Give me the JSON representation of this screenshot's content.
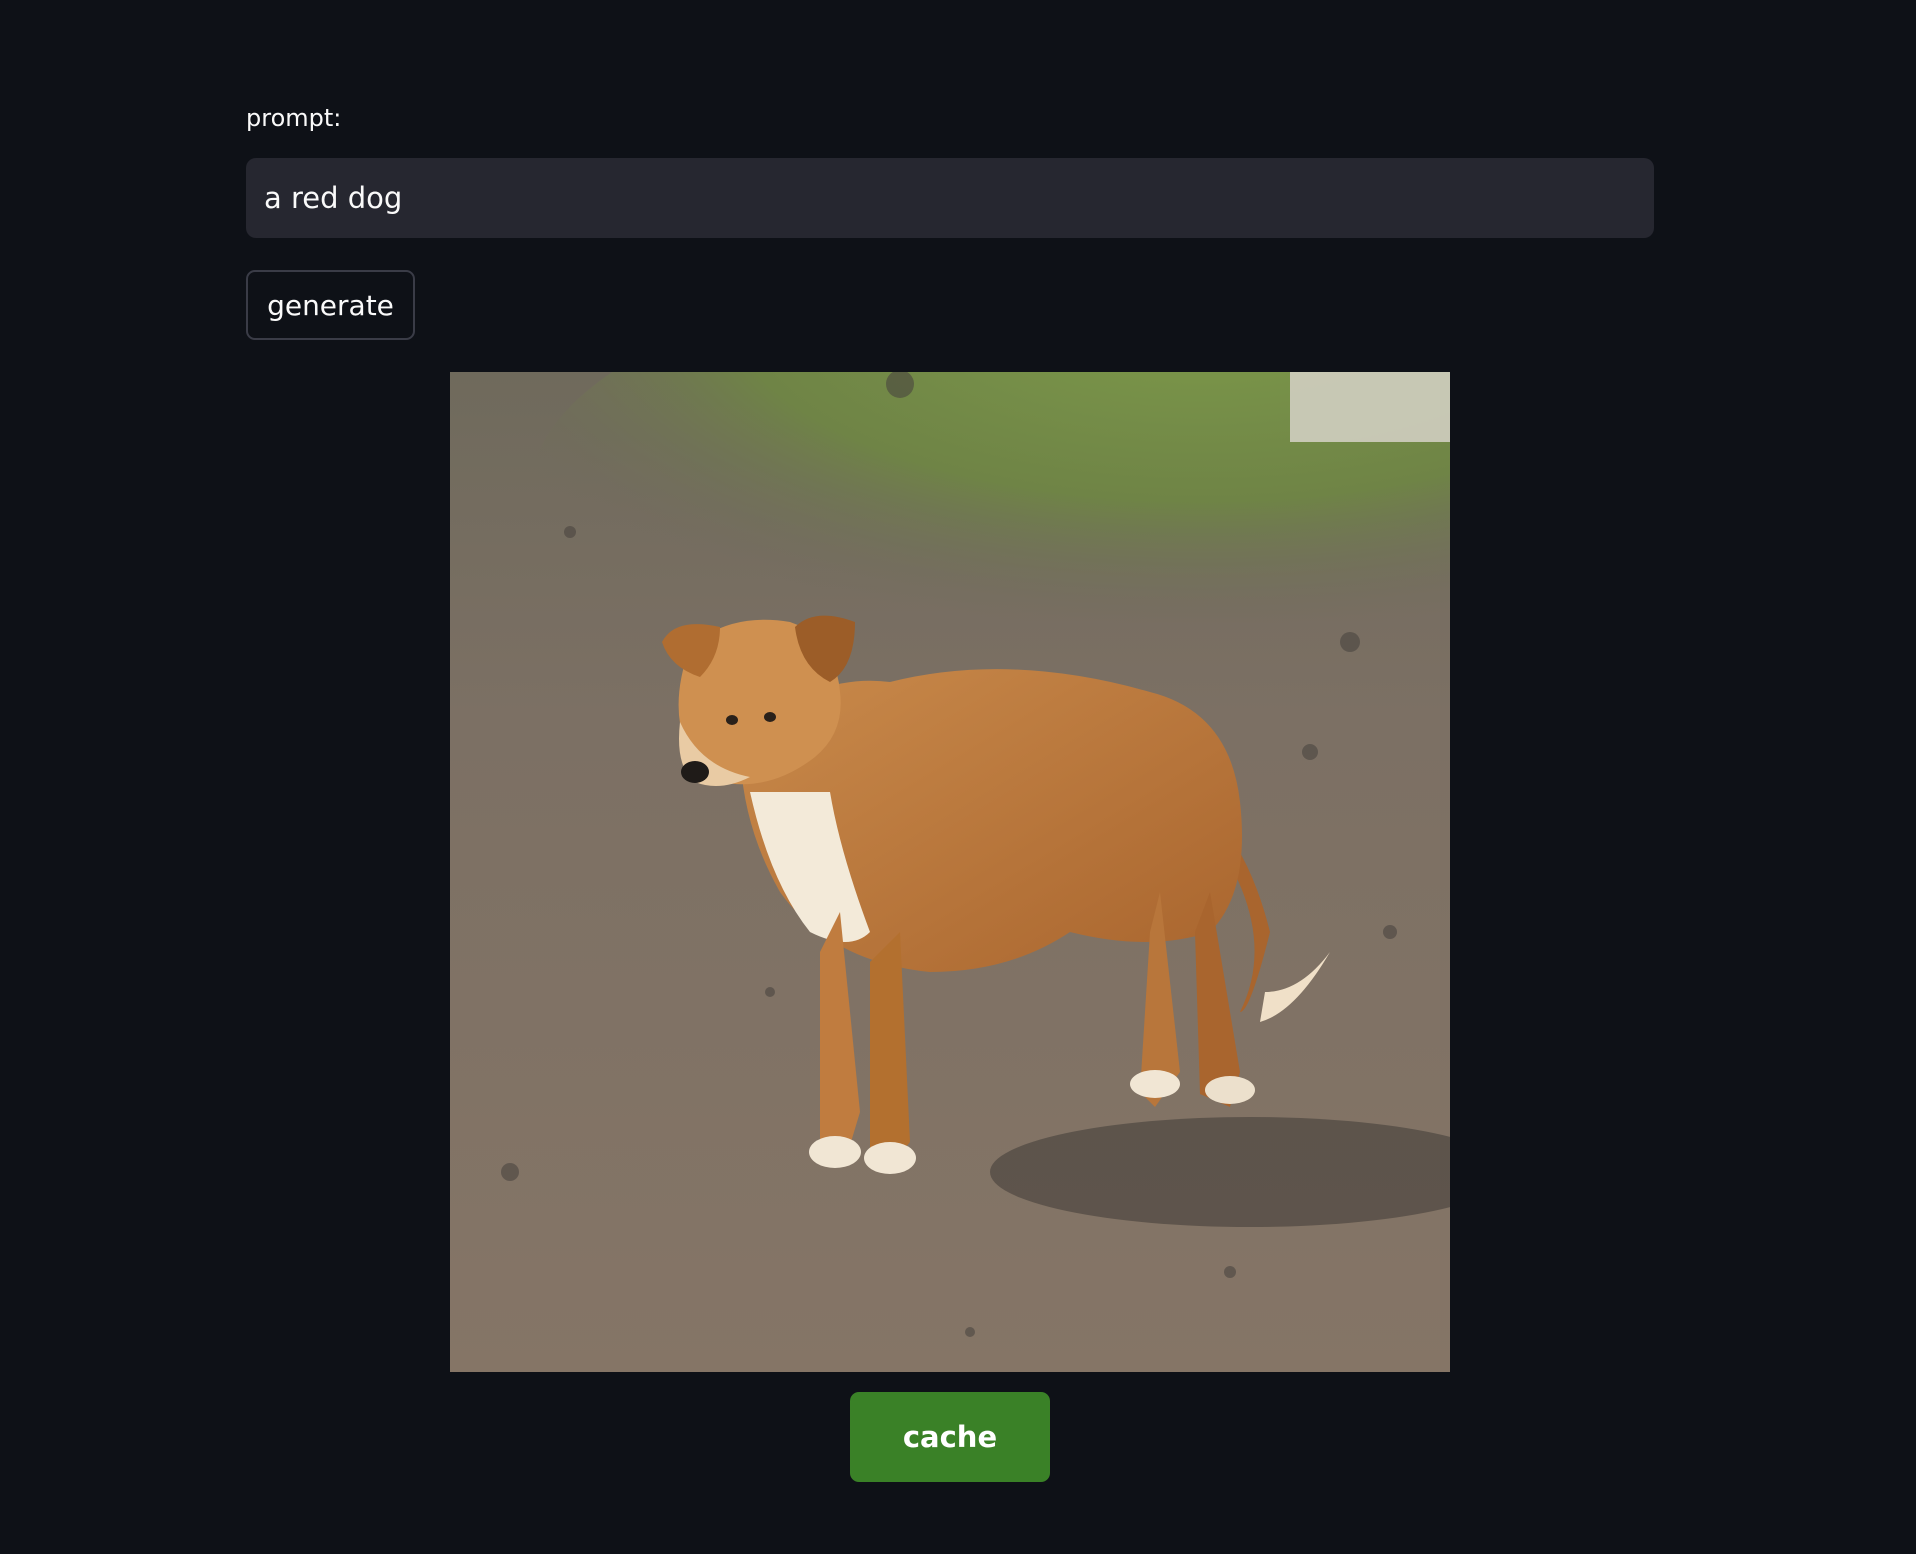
{
  "form": {
    "prompt_label": "prompt:",
    "prompt_value": "a red dog",
    "generate_label": "generate"
  },
  "result": {
    "cache_label": "cache"
  },
  "colors": {
    "background": "#0e1117",
    "input_bg": "#262730",
    "cache_button": "#3a8127"
  }
}
